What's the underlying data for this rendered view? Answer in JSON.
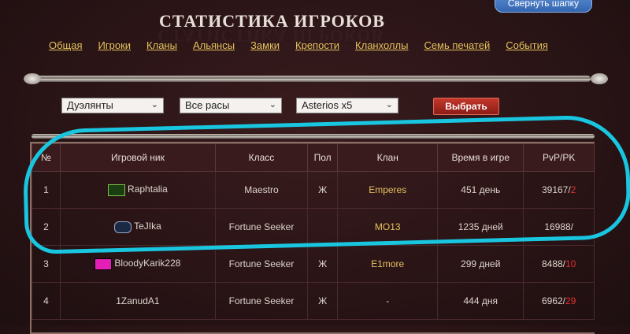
{
  "header": {
    "collapse_button": "Свернуть шапку",
    "title": "СТАТИСТИКА ИГРОКОВ",
    "nav": [
      "Общая",
      "Игроки",
      "Кланы",
      "Альянсы",
      "Замки",
      "Крепости",
      "Кланхоллы",
      "Семь печатей",
      "События"
    ]
  },
  "filters": {
    "category": "Дуэлянты",
    "race": "Все расы",
    "server": "Asterios x5",
    "submit": "Выбрать"
  },
  "table": {
    "columns": [
      "№",
      "Игровой ник",
      "Класс",
      "Пол",
      "Клан",
      "Время в игре",
      "PvP/PK"
    ],
    "rows": [
      {
        "rank": "1",
        "nick": "Raphtalia",
        "class": "Maestro",
        "sex": "Ж",
        "clan": "Emperes",
        "time": "451 день",
        "pvp": "39167/",
        "pk": "2"
      },
      {
        "rank": "2",
        "nick": "TeJIka",
        "class": "Fortune Seeker",
        "sex": "",
        "clan": "MO13",
        "time": "1235 дней",
        "pvp": "16988/",
        "pk": ""
      },
      {
        "rank": "3",
        "nick": "BloodyKarik228",
        "class": "Fortune Seeker",
        "sex": "Ж",
        "clan": "E1more",
        "time": "299 дней",
        "pvp": "8488/",
        "pk": "10"
      },
      {
        "rank": "4",
        "nick": "1ZanudA1",
        "class": "Fortune Seeker",
        "sex": "Ж",
        "clan": "-",
        "time": "444 дня",
        "pvp": "6962/",
        "pk": "29"
      }
    ]
  },
  "colors": {
    "accent_gold": "#e3c25d",
    "pk_red": "#e03030",
    "highlight_stroke": "#19c6e0"
  }
}
